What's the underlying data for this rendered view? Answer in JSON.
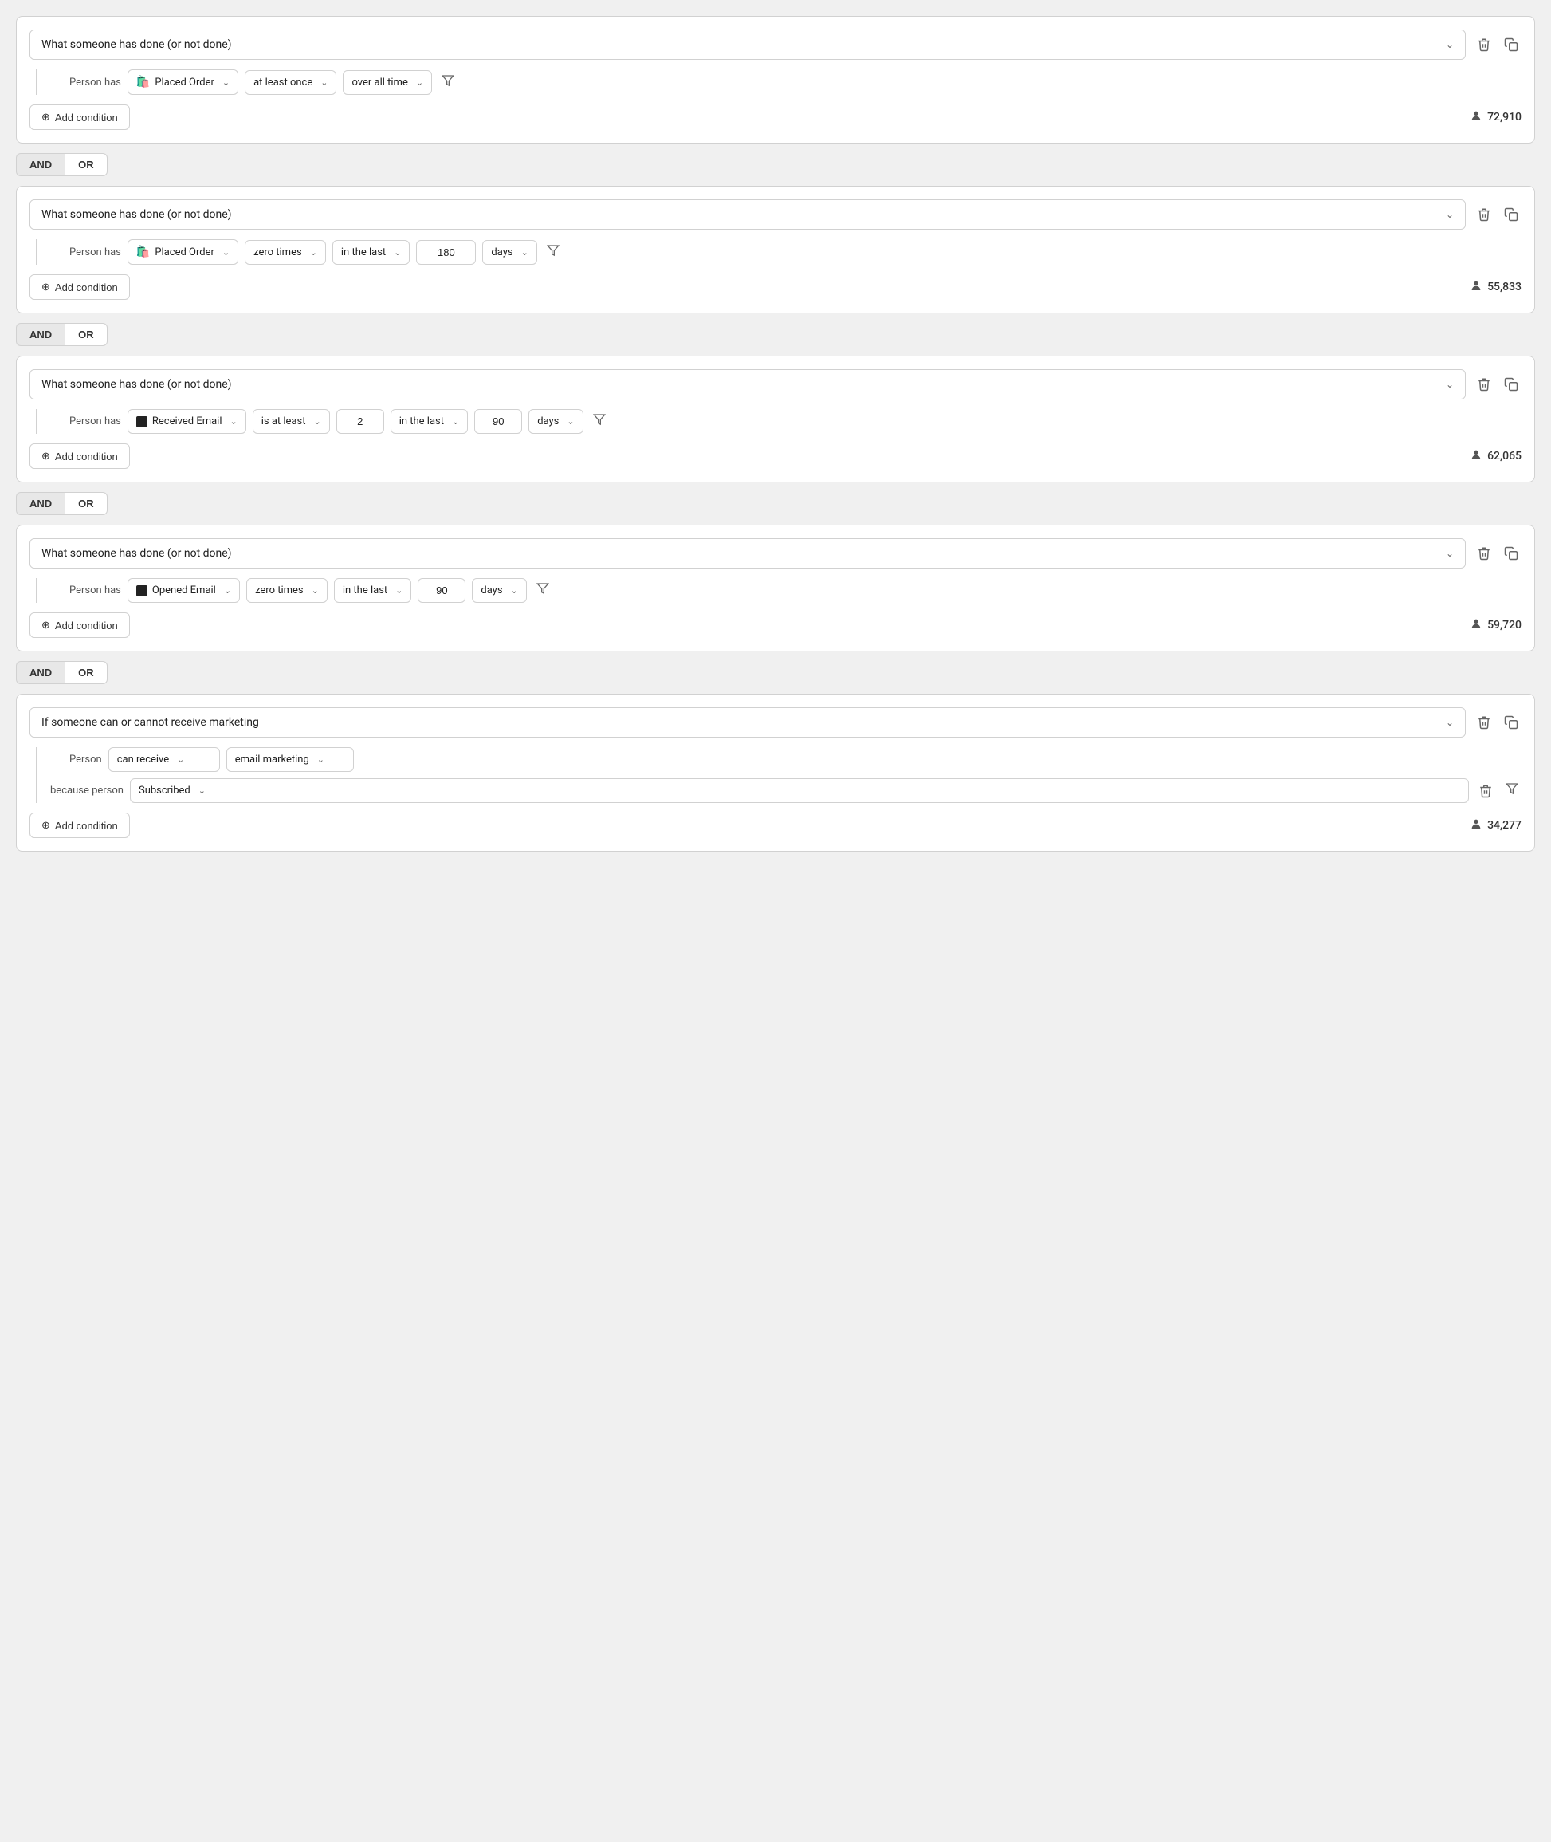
{
  "blocks": [
    {
      "id": "block1",
      "title": "What someone has done (or not done)",
      "count": "72,910",
      "conditions": [
        {
          "type": "person-has",
          "action_icon": "shopify",
          "action": "Placed Order",
          "frequency": "at least once",
          "timeframe": "over all time",
          "hasNumber": false,
          "hasDays": false,
          "hasFilter": true
        }
      ]
    },
    {
      "id": "block2",
      "title": "What someone has done (or not done)",
      "count": "55,833",
      "conditions": [
        {
          "type": "person-has",
          "action_icon": "shopify",
          "action": "Placed Order",
          "frequency": "zero times",
          "timeframe": "in the last",
          "number": "180",
          "daysUnit": "days",
          "hasNumber": true,
          "hasDays": true,
          "hasFilter": true
        }
      ]
    },
    {
      "id": "block3",
      "title": "What someone has done (or not done)",
      "count": "62,065",
      "conditions": [
        {
          "type": "person-has",
          "action_icon": "email",
          "action": "Received Email",
          "frequency": "is at least",
          "count_num": "2",
          "timeframe": "in the last",
          "number": "90",
          "daysUnit": "days",
          "hasNumber": true,
          "hasDays": true,
          "hasFilter": true
        }
      ]
    },
    {
      "id": "block4",
      "title": "What someone has done (or not done)",
      "count": "59,720",
      "conditions": [
        {
          "type": "person-has",
          "action_icon": "email",
          "action": "Opened Email",
          "frequency": "zero times",
          "timeframe": "in the last",
          "number": "90",
          "daysUnit": "days",
          "hasNumber": false,
          "hasDays": true,
          "hasFilter": true
        }
      ]
    },
    {
      "id": "block5",
      "title": "If someone can or cannot receive marketing",
      "count": "34,277",
      "isMarketing": true,
      "conditions": [
        {
          "type": "marketing",
          "canReceive": "can receive",
          "marketingType": "email marketing"
        }
      ],
      "subCondition": {
        "label": "because person",
        "value": "Subscribed"
      }
    }
  ],
  "andOrLabel": {
    "and": "AND",
    "or": "OR"
  },
  "addConditionLabel": "Add condition",
  "icons": {
    "delete": "🗑",
    "copy": "⧉",
    "filter": "⊘",
    "plus": "⊕",
    "person": "👤",
    "chevron": "∨"
  }
}
